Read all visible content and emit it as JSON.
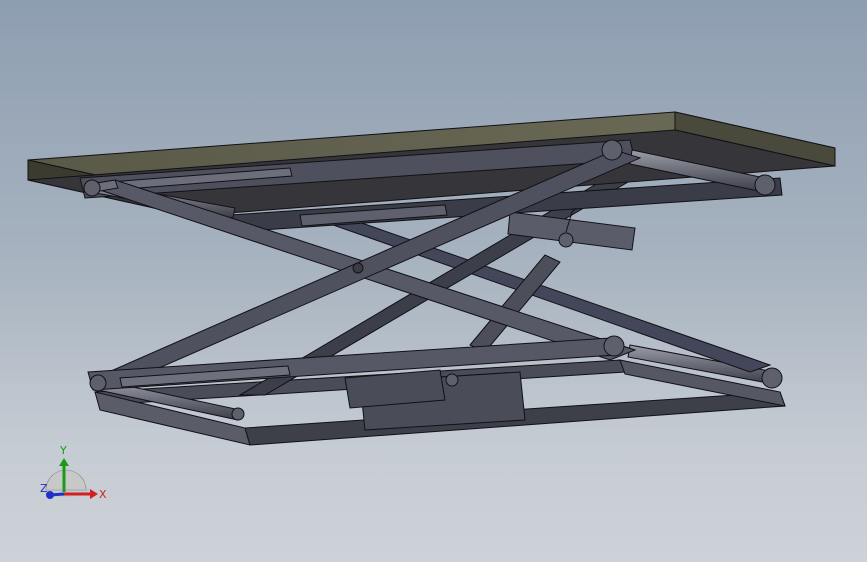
{
  "viewport": {
    "background_top": "#8e9eb1",
    "background_bottom": "#cdd2d8"
  },
  "model": {
    "name": "scissor-lift-table",
    "part_color": "#4e505d",
    "part_dark": "#2e2f37",
    "part_light": "#6c6e7c",
    "edge_color": "#111116"
  },
  "triad": {
    "x_label": "X",
    "y_label": "Y",
    "z_label": "Z",
    "x_color": "#d02020",
    "y_color": "#1a9a1a",
    "z_color": "#2030c8"
  }
}
